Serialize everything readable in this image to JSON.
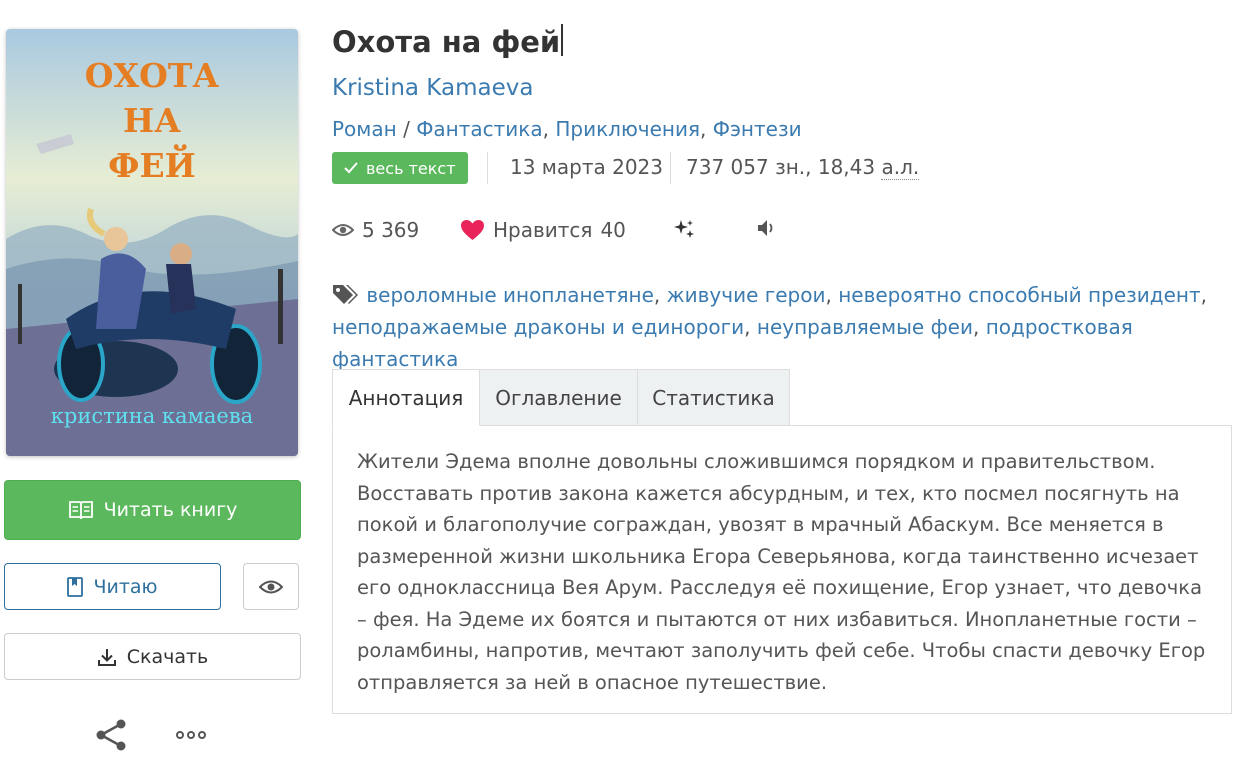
{
  "book": {
    "title": "Охота на фей",
    "author": "Kristina Kamaeva",
    "genre_form": "Роман",
    "genre_sep": "/",
    "genres": [
      "Фантастика",
      "Приключения",
      "Фэнтези"
    ],
    "genre_comma": ","
  },
  "cover": {
    "title_line1": "ОХОТА",
    "title_line2": "НА",
    "title_line3": "ФЕЙ",
    "author": "кристина камаева"
  },
  "meta": {
    "badge": "весь текст",
    "date": "13 марта 2023",
    "size_prefix": "737 057 зн., 18,43 ",
    "size_unit": "а.л."
  },
  "stats": {
    "views": "5 369",
    "likes_label": "Нравится",
    "likes_count": "40"
  },
  "tags": [
    "вероломные инопланетяне",
    "живучие герои",
    "невероятно способный президент",
    "неподражаемые драконы и единороги",
    "неуправляемые феи",
    "подростковая фантастика"
  ],
  "tabs": [
    "Аннотация",
    "Оглавление",
    "Статистика"
  ],
  "annotation": "Жители Эдема вполне довольны сложившимся порядком и правительством. Восставать против закона кажется абсурдным, и тех, кто посмел посягнуть на покой и благополучие сограждан, увозят в мрачный Абаскум. Все меняется в размеренной жизни школьника Егора Северьянова, когда таинственно исчезает его одноклассница Вея Арум. Расследуя её похищение, Егор узнает, что девочка – фея. На Эдеме их боятся и пытаются от них избавиться. Инопланетные гости – роламбины, напротив, мечтают заполучить фей себе. Чтобы спасти девочку Егор отправляется за ней в опасное путешествие.",
  "buttons": {
    "read": "Читать книгу",
    "reading": "Читаю",
    "download": "Скачать"
  },
  "colors": {
    "green": "#5cb85c",
    "link": "#3b7bb0",
    "heart": "#e8245a"
  }
}
